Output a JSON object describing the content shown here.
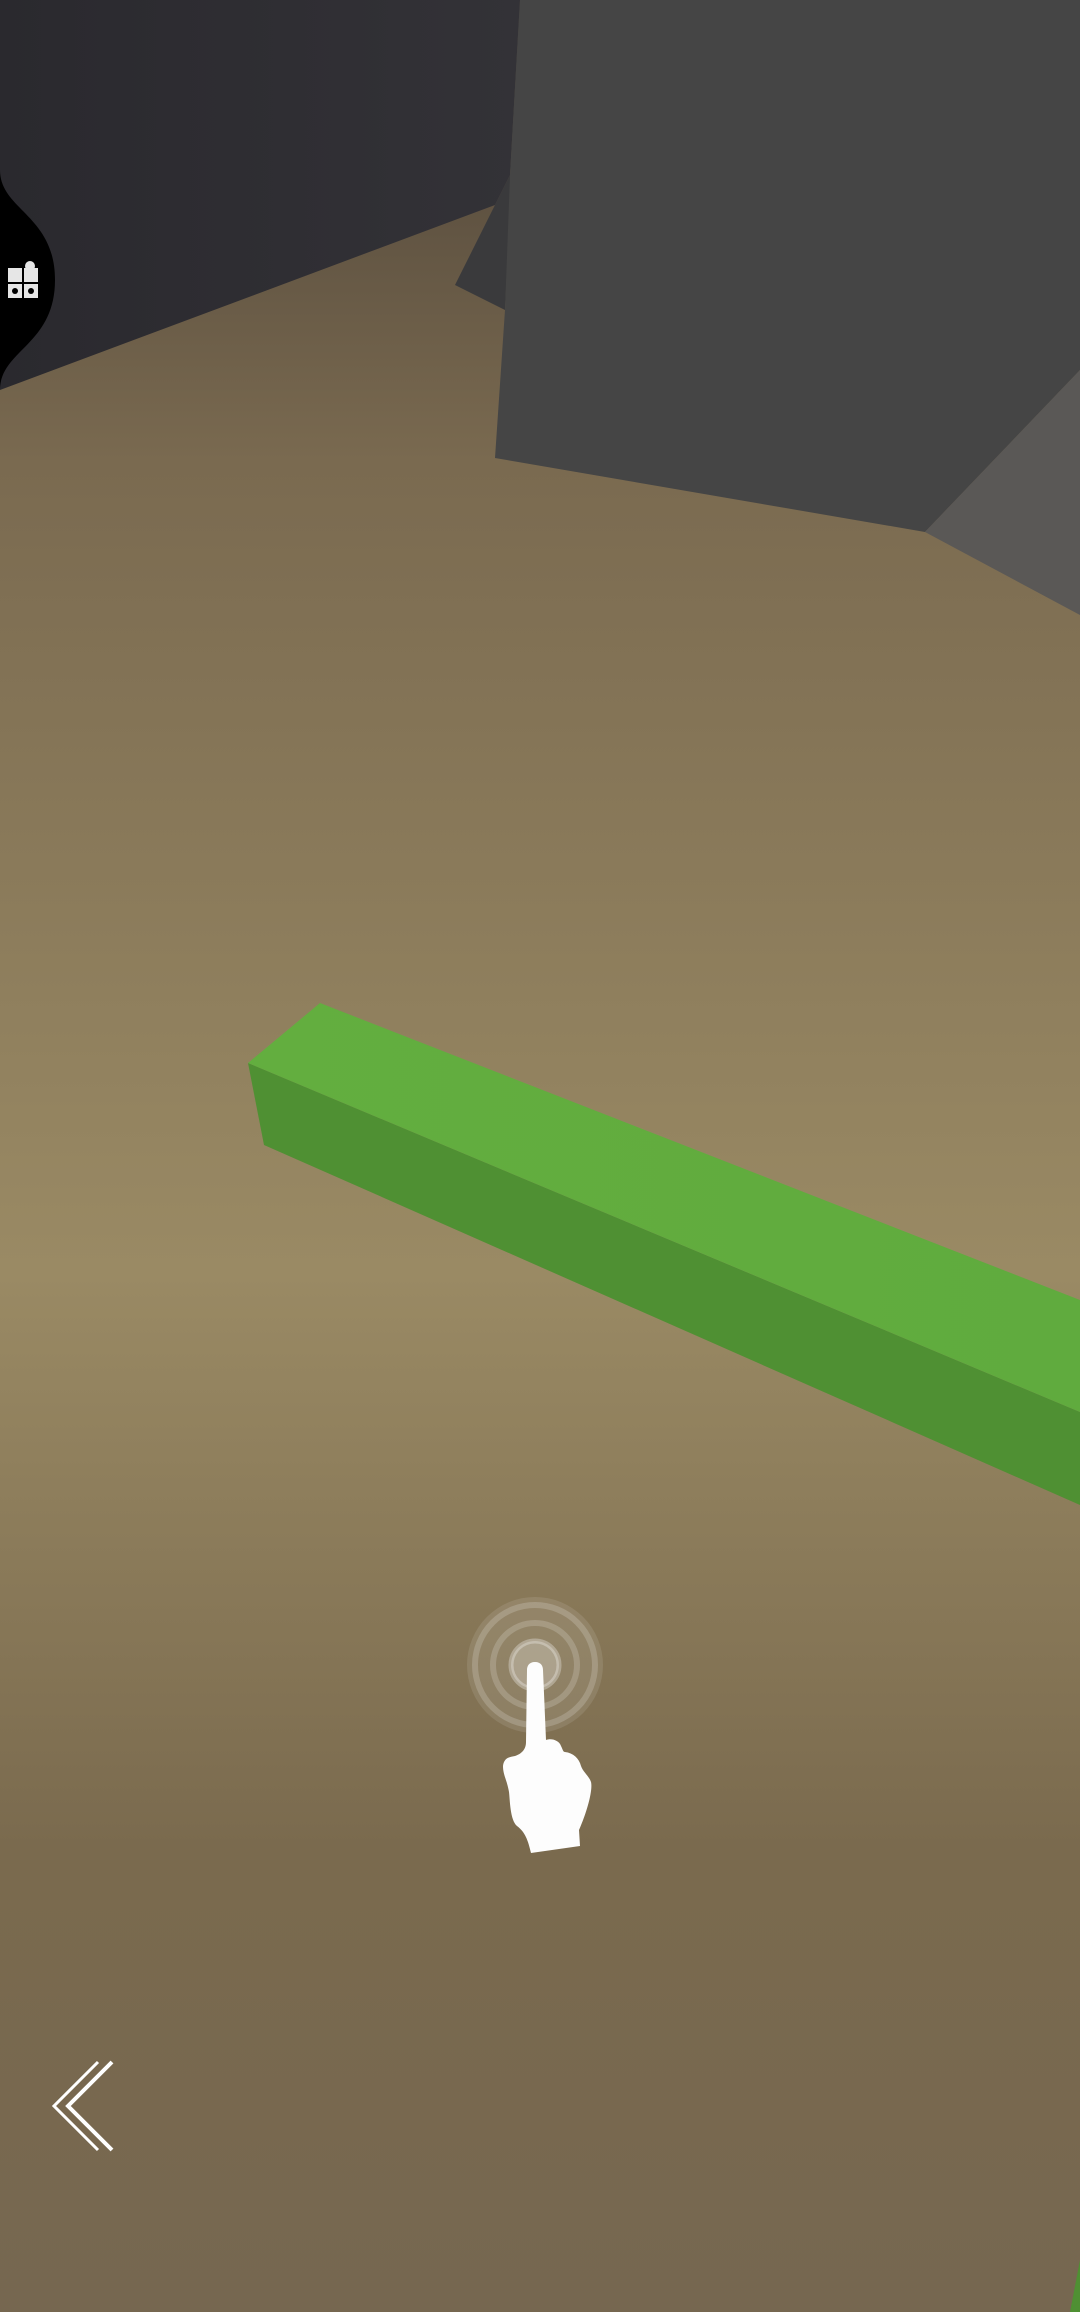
{
  "colors": {
    "floor_top": "#4a4036",
    "floor_mid": "#9a8a64",
    "floor_bottom": "#766750",
    "wall_dark": "#2d2c31",
    "wall_block": "#454545",
    "wall_block_side": "#5a5855",
    "beam_top": "#62ad3e",
    "beam_side": "#4f9033",
    "hint_white": "#ffffff"
  },
  "icons": {
    "side_tab": "puzzle-piece-icon",
    "tap_hint": "tap-hand-icon",
    "back": "chevron-left-icon"
  }
}
